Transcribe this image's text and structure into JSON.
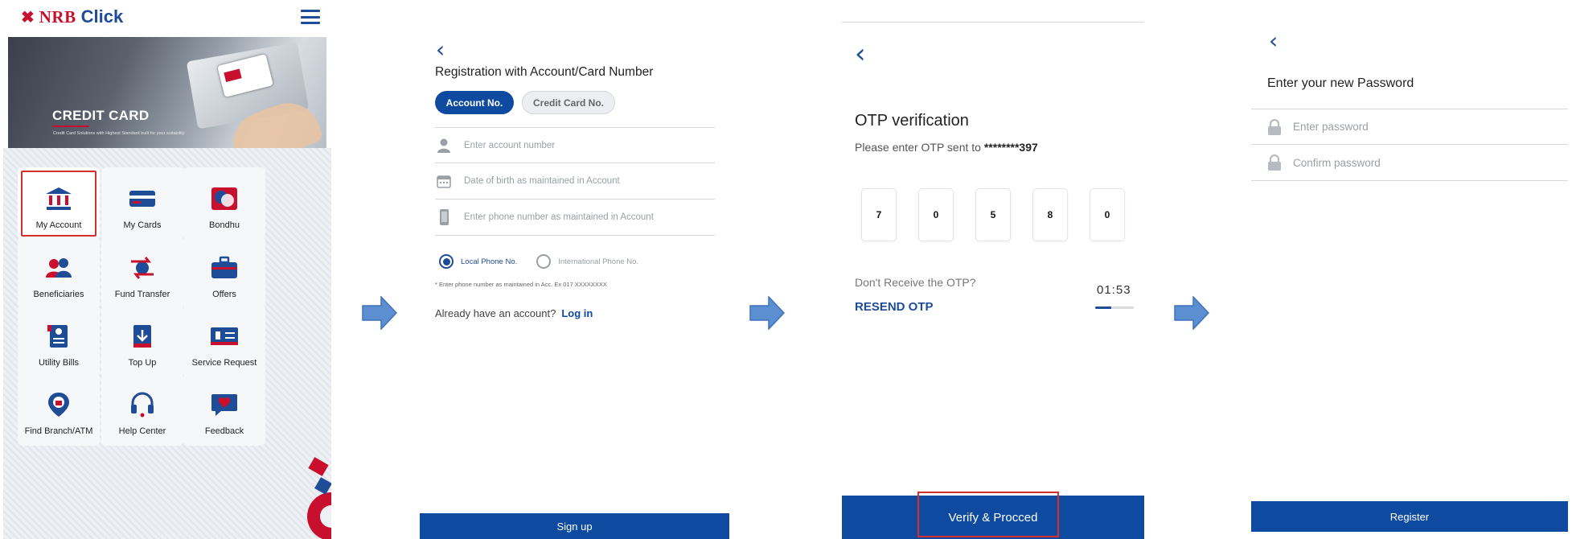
{
  "home": {
    "logo": {
      "brand_nrb": "NRB",
      "brand_click": "Click"
    },
    "banner": {
      "title": "CREDIT CARD",
      "subtitle": "Credit Card Solutions with Highest Standard built for your suitability",
      "slide_count": 2,
      "active_slide": 2
    },
    "tiles": [
      {
        "label": "My Account",
        "icon": "bank-icon",
        "highlighted": true
      },
      {
        "label": "My Cards",
        "icon": "card-icon",
        "highlighted": false
      },
      {
        "label": "Bondhu",
        "icon": "bondhu-icon",
        "highlighted": false
      },
      {
        "label": "Beneficiaries",
        "icon": "users-icon",
        "highlighted": false
      },
      {
        "label": "Fund Transfer",
        "icon": "transfer-icon",
        "highlighted": false
      },
      {
        "label": "Offers",
        "icon": "briefcase-icon",
        "highlighted": false
      },
      {
        "label": "Utility Bills",
        "icon": "bill-icon",
        "highlighted": false
      },
      {
        "label": "Top Up",
        "icon": "topup-icon",
        "highlighted": false
      },
      {
        "label": "Service Request",
        "icon": "service-icon",
        "highlighted": false
      },
      {
        "label": "Find Branch/ATM",
        "icon": "location-icon",
        "highlighted": false
      },
      {
        "label": "Help Center",
        "icon": "headset-icon",
        "highlighted": false
      },
      {
        "label": "Feedback",
        "icon": "heart-chat-icon",
        "highlighted": false
      }
    ]
  },
  "registration": {
    "title": "Registration with Account/Card Number",
    "tabs": [
      {
        "label": "Account No.",
        "active": true
      },
      {
        "label": "Credit Card No.",
        "active": false
      }
    ],
    "fields": {
      "account_placeholder": "Enter account number",
      "dob_placeholder": "Date of birth as maintained in Account",
      "phone_placeholder": "Enter phone number as maintained in Account"
    },
    "radio": {
      "local_label": "Local Phone No.",
      "international_label": "International Phone No.",
      "selected": "local"
    },
    "hint": "* Enter phone number as maintained in Acc. Ex 017 XXXXXXXX",
    "login_prompt": "Already have an account?",
    "login_link": "Log in",
    "signup_label": "Sign up"
  },
  "otp": {
    "title": "OTP verification",
    "subtitle_prefix": "Please enter OTP sent to",
    "masked_number": "********397",
    "digits": [
      "7",
      "0",
      "5",
      "8",
      "0"
    ],
    "no_otp_question": "Don't Receive the OTP?",
    "resend_label": "RESEND OTP",
    "timer": "01:53",
    "timer_progress": 0.42,
    "verify_label": "Verify & Procced"
  },
  "new_password": {
    "title": "Enter your new Password",
    "password_placeholder": "Enter password",
    "confirm_placeholder": "Confirm password",
    "register_label": "Register"
  },
  "colors": {
    "brand_blue": "#0d4aa0",
    "brand_red": "#c8102e",
    "highlight_red": "#d32f2f",
    "arrow_blue": "#5b8fd1"
  }
}
